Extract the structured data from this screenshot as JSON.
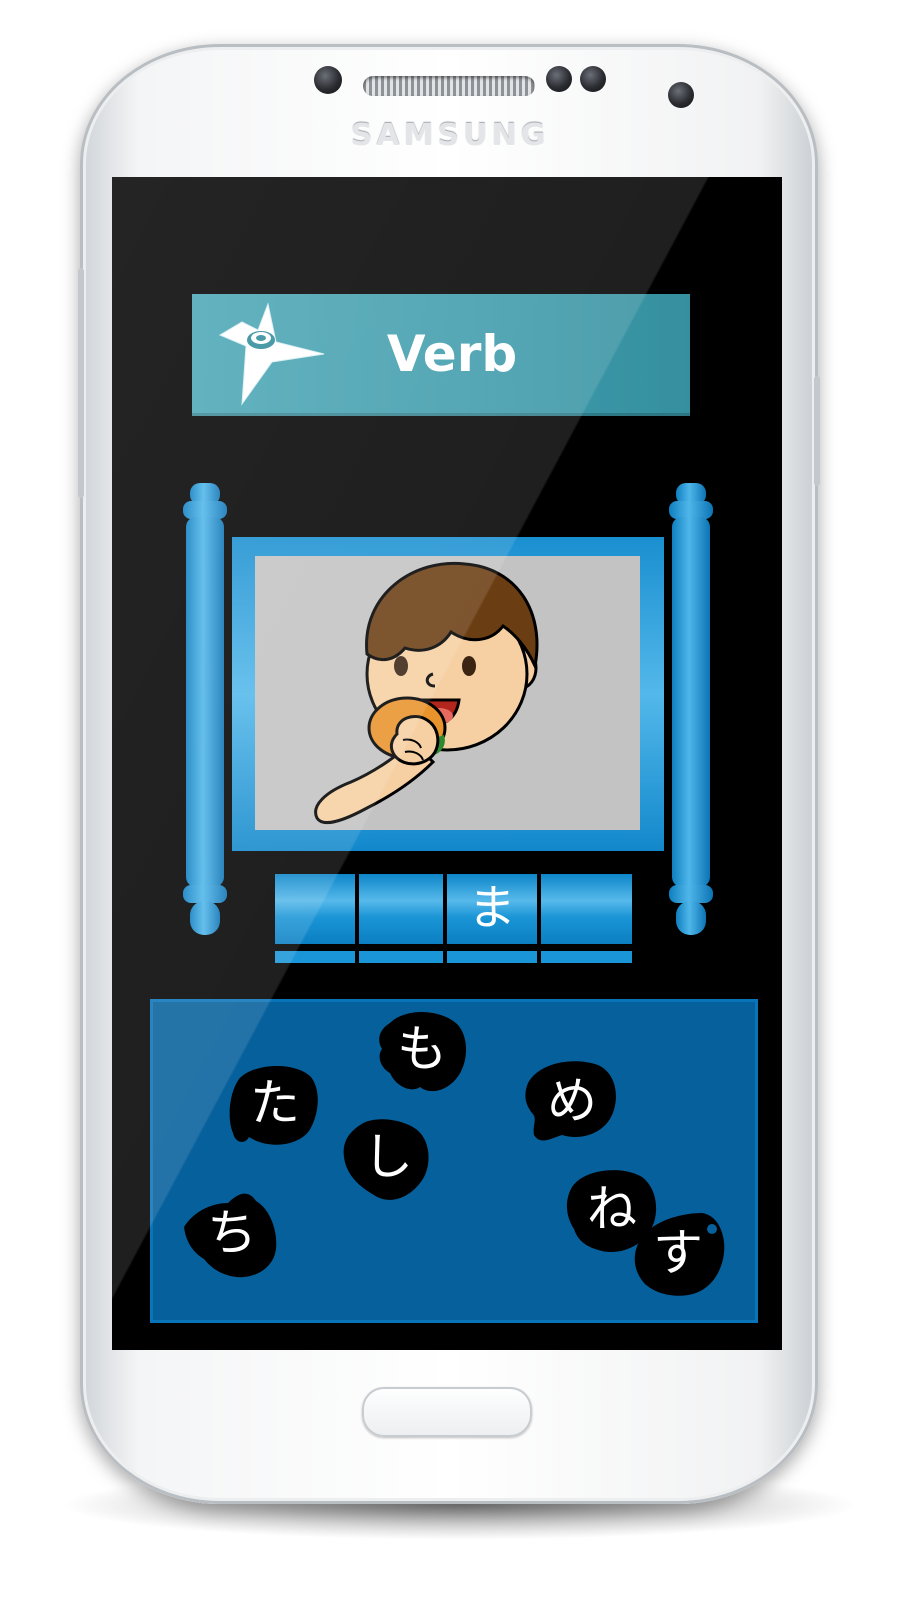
{
  "device": {
    "brand": "SAMSUNG"
  },
  "game": {
    "category_title": "Verb",
    "answer_slots": [
      "",
      "",
      "ま",
      ""
    ],
    "tiles": [
      "も",
      "た",
      "め",
      "し",
      "ち",
      "ね",
      "す"
    ]
  },
  "colors": {
    "banner": "#3d9aaa",
    "scroll_blue": "#1a8fd0",
    "tray": "#06609c",
    "tile": "#000000",
    "picture_bg": "#c3c3c3"
  },
  "icons": {
    "banner_icon": "shuriken-icon",
    "picture": "boy-eating-burger"
  }
}
